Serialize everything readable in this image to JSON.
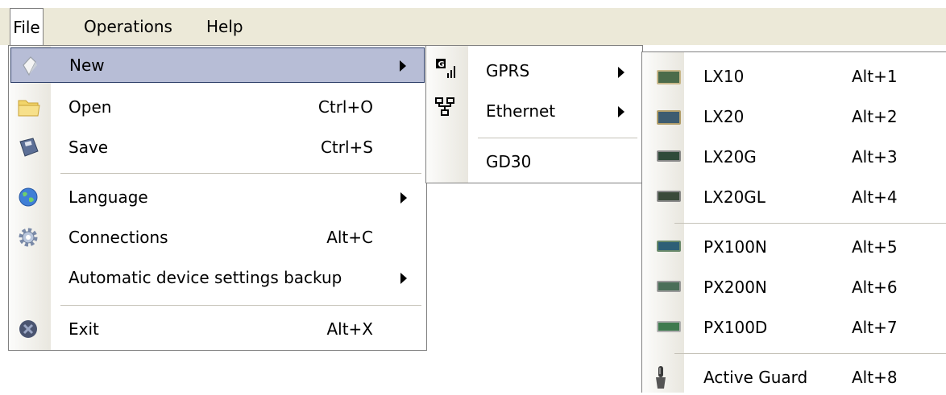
{
  "menubar": {
    "file": "File",
    "operations": "Operations",
    "help": "Help"
  },
  "file_menu": {
    "items": [
      {
        "label": "New",
        "shortcut": "",
        "icon": "new-document-icon"
      },
      {
        "label": "Open",
        "shortcut": "Ctrl+O",
        "icon": "folder-icon"
      },
      {
        "label": "Save",
        "shortcut": "Ctrl+S",
        "icon": "floppy-disk-icon"
      },
      {
        "label": "Language",
        "shortcut": "",
        "icon": "globe-icon"
      },
      {
        "label": "Connections",
        "shortcut": "Alt+C",
        "icon": "gear-icon"
      },
      {
        "label": "Automatic device settings backup",
        "shortcut": "",
        "icon": ""
      },
      {
        "label": "Exit",
        "shortcut": "Alt+X",
        "icon": "exit-icon"
      }
    ]
  },
  "new_menu": {
    "items": [
      {
        "label": "GPRS",
        "icon": "gprs-signal-icon"
      },
      {
        "label": "Ethernet",
        "icon": "network-icon"
      },
      {
        "label": "GD30",
        "icon": ""
      }
    ]
  },
  "device_menu": {
    "items": [
      {
        "label": "LX10",
        "shortcut": "Alt+1",
        "icon": "device-board-icon"
      },
      {
        "label": "LX20",
        "shortcut": "Alt+2",
        "icon": "device-board-icon"
      },
      {
        "label": "LX20G",
        "shortcut": "Alt+3",
        "icon": "device-board-icon"
      },
      {
        "label": "LX20GL",
        "shortcut": "Alt+4",
        "icon": "device-board-icon"
      },
      {
        "label": "PX100N",
        "shortcut": "Alt+5",
        "icon": "device-board-icon"
      },
      {
        "label": "PX200N",
        "shortcut": "Alt+6",
        "icon": "device-board-icon"
      },
      {
        "label": "PX100D",
        "shortcut": "Alt+7",
        "icon": "device-board-icon"
      },
      {
        "label": "Active Guard",
        "shortcut": "Alt+8",
        "icon": "sensor-probe-icon"
      }
    ]
  },
  "colors": {
    "highlight": "#b7bdd6",
    "highlight_border": "#31426b",
    "menubar_bg": "#ece9d8"
  }
}
